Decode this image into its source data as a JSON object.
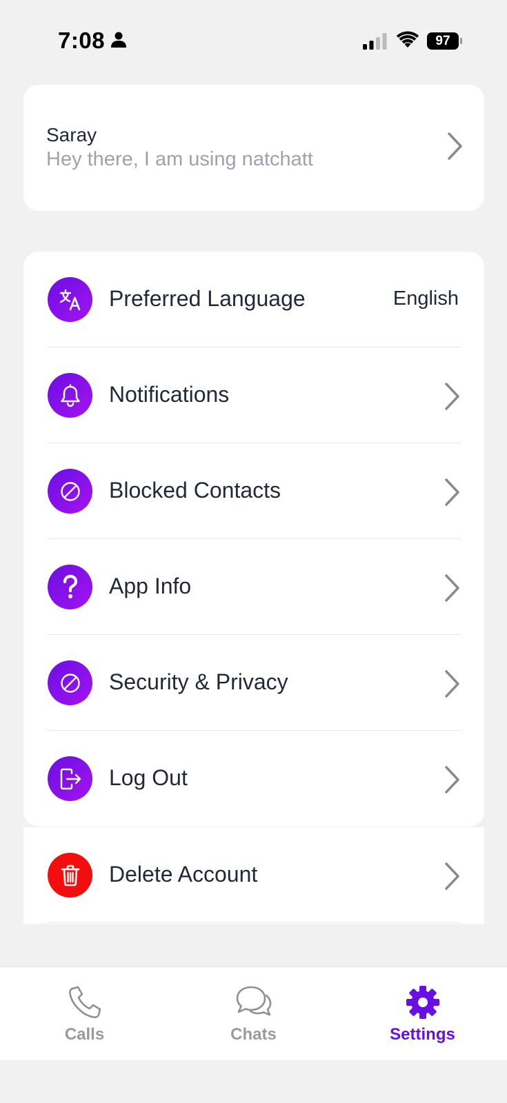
{
  "status_bar": {
    "time": "7:08",
    "battery": "97"
  },
  "profile": {
    "name": "Saray",
    "status": "Hey there, I am using natchatt"
  },
  "settings": {
    "items": [
      {
        "label": "Preferred Language",
        "value": "English",
        "icon": "translate-icon"
      },
      {
        "label": "Notifications",
        "icon": "bell-icon"
      },
      {
        "label": "Blocked Contacts",
        "icon": "block-icon"
      },
      {
        "label": "App Info",
        "icon": "question-icon"
      },
      {
        "label": "Security & Privacy",
        "icon": "block-icon"
      },
      {
        "label": "Log Out",
        "icon": "logout-icon"
      }
    ],
    "delete": {
      "label": "Delete Account",
      "icon": "trash-icon"
    }
  },
  "tab_bar": {
    "tabs": [
      {
        "label": "Calls",
        "icon": "phone-icon"
      },
      {
        "label": "Chats",
        "icon": "chat-bubbles-icon"
      },
      {
        "label": "Settings",
        "icon": "gear-icon",
        "active": true
      }
    ]
  },
  "colors": {
    "accent": "#6a0fe3",
    "accent_gradient_end": "#a513f0",
    "danger": "#f40d0d",
    "background": "#f1f1f1",
    "inactive_tab": "#9a9a9a"
  }
}
